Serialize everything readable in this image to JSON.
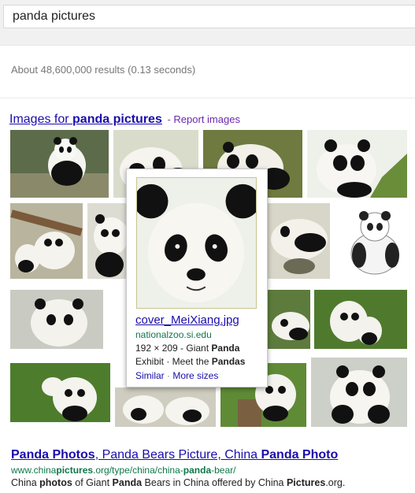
{
  "search": {
    "query": "panda pictures"
  },
  "stats": {
    "text": "About 48,600,000 results (0.13 seconds)"
  },
  "images_header": {
    "prefix": "Images for ",
    "query": "panda pictures",
    "separator": " - ",
    "report_label": "Report images"
  },
  "popup": {
    "title": "cover_MeiXiang.jpg",
    "domain": "nationalzoo.si.edu",
    "dims": "192 × 209 - Giant ",
    "dims_bold": "Panda",
    "desc_a": "Exhibit · Meet the ",
    "desc_bold": "Pandas",
    "similar_label": "Similar",
    "dot": " · ",
    "more_sizes_label": "More sizes"
  },
  "result": {
    "title_a": "Panda Photos",
    "title_b": ", Panda Bears Picture, China ",
    "title_c": "Panda Photo",
    "url_a": "www.china",
    "url_b": "pictures",
    "url_c": ".org/type/china/china-",
    "url_d": "panda",
    "url_e": "-bear/",
    "snippet_a": "China ",
    "snippet_b": "photos",
    "snippet_c": " of Giant ",
    "snippet_d": "Panda",
    "snippet_e": " Bears in China offered by China ",
    "snippet_f": "Pictures",
    "snippet_g": ".org."
  }
}
